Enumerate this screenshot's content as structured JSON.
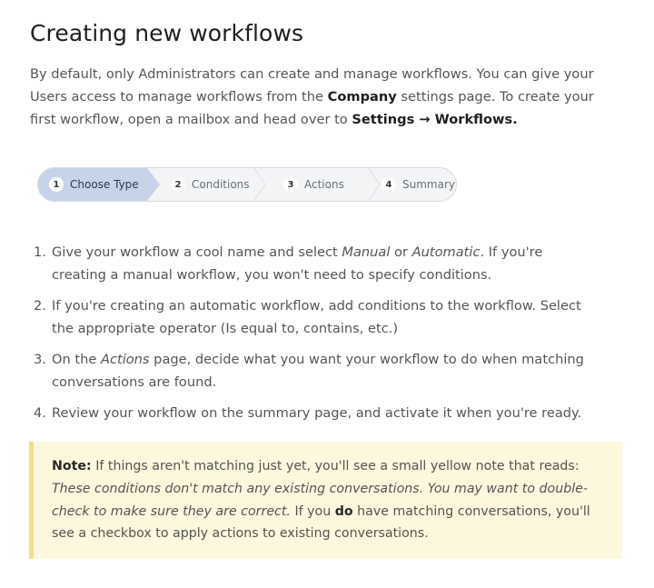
{
  "title": "Creating new workflows",
  "intro": {
    "part1": "By default, only Administrators can create and manage workflows. You can give your Users access to manage workflows from the ",
    "company": "Company",
    "part2": " settings page. To create your first workflow, open a mailbox and head over to ",
    "settings_path": "Settings → Workflows."
  },
  "stepper": {
    "steps": [
      {
        "num": "1",
        "label": "Choose Type"
      },
      {
        "num": "2",
        "label": "Conditions"
      },
      {
        "num": "3",
        "label": "Actions"
      },
      {
        "num": "4",
        "label": "Summary"
      }
    ]
  },
  "list": {
    "items": [
      {
        "n": "1.",
        "a": "Give your workflow a cool name and select ",
        "manual": "Manual",
        "or": " or ",
        "automatic": "Automatic",
        "b": ". If you're creating a manual workflow, you won't need to specify conditions."
      },
      {
        "n": "2.",
        "text": "If you're creating an automatic workflow, add conditions to the workflow. Select the appropriate operator (Is equal to, contains, etc.)"
      },
      {
        "n": "3.",
        "a": "On the ",
        "actions": "Actions",
        "b": " page, decide what you want your workflow to do when matching conversations are found."
      },
      {
        "n": "4.",
        "text": "Review your workflow on the summary page, and activate it when you're ready."
      }
    ]
  },
  "note": {
    "label": "Note:",
    "part1": " If things aren't matching just yet, you'll see a small yellow note that reads: ",
    "quote": "These conditions don't match any existing conversations. You may want to double-check to make sure they are correct.",
    "part2": " If you ",
    "do": "do",
    "part3": " have matching conversations, you'll see a checkbox to apply actions to existing conversations."
  },
  "colors": {
    "active_step": "#c6d3e8",
    "note_bg": "#fdf7dd",
    "note_border": "#f5dd8a"
  }
}
